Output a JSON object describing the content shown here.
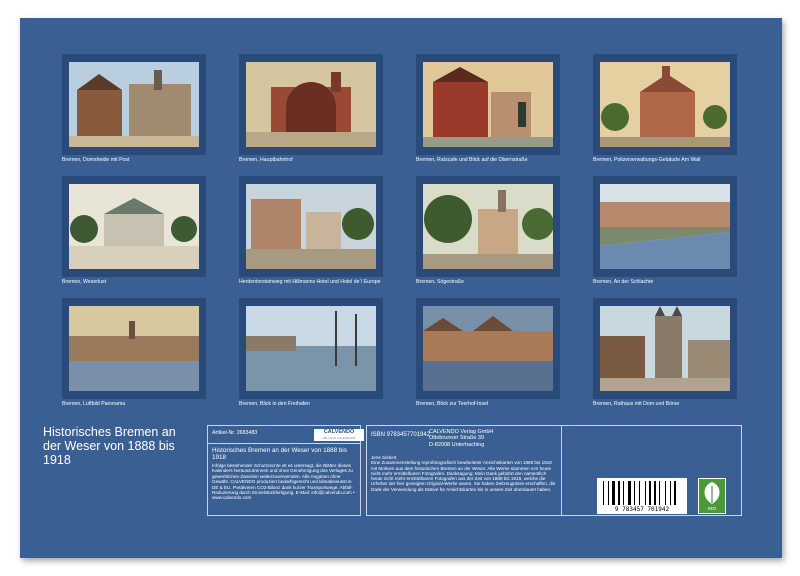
{
  "captions": [
    "Bremen, Domsheide mit Post",
    "Bremen, Hauptbahnhof",
    "Bremen, Ratscafe und Blick auf die Obernstraße",
    "Bremen, Polizeiverwaltungs-Gebäude Am Wall",
    "Bremen, Weserlust",
    "Herdentorsteinweg mit Hillmanns Hotel und Hotel de´l Europe",
    "Bremen, Sögestraße",
    "Bremen, An der Schlachte",
    "Bremen, Luftbild Panorama",
    "Bremen, Blick in den Freihafen",
    "Bremen, Blick zur Teerhof-Insel",
    "Bremen, Rathaus mit Dom und Börse"
  ],
  "title": "Historisches Bremen an der Weser von 1888 bis 1918",
  "article": "Artikel-Nr. 2683483",
  "logo": "CALVENDO",
  "logo_sub": "WE LOVE CALENDARS",
  "subtitle": "Historisches Bremen an der Weser von 1888 bis 1918",
  "legal": "Infolge bestehender Schutzrechte ist es untersagt, die Blätter dieses Kalenders herauszutrennen und ohne Genehmigung des Verlages zu gewerblichen Zwecken weiterzuverwenden. Alle Angaben ohne Gewähr. CALVENDO produziert bedarfsgerecht und klimabewusst in DE & EU. Positiveren CO2-Bilanz dank kurzer Transportwege. Abfall-Reduzierung durch Einzelstückfertigung. E-Mail: info@calvendo.com • www.calvendo.com",
  "isbn": "ISBN 9783457701942",
  "publisher": [
    "CALVENDO Verlag GmbH",
    "Ottobrunner Straße 39",
    "D-82008 Unterhaching"
  ],
  "author": "Jens Siebert",
  "description": "Eine Zusammenstellung reprofotografisch bearbeiteter Ansichtskarten von 1888 bis 1918 mit Motiven aus dem historischen Bremen an der Weser. Alle Werke stammen von heute nicht mehr ermittelbaren Fotografen. Danksagung: Mein Dank gebührt den namentlich heute nicht mehr ermittelbaren Fotografen aus der Zeit von 1888 bis 1918, welche die Urheber der hier gezeigten Original-Werke waren. Sie haben Zeitzeugnisse erschaffen, die Dank der Verwendung als Motive für Ansichtskarten bis in unsere Zeit überdauert haben.",
  "barcode_number": "9 783457 701942",
  "eco_label": "eco",
  "colors": {
    "sheet": "#3a5f93",
    "frame": "#2a4b7a",
    "text": "#ffffff"
  }
}
